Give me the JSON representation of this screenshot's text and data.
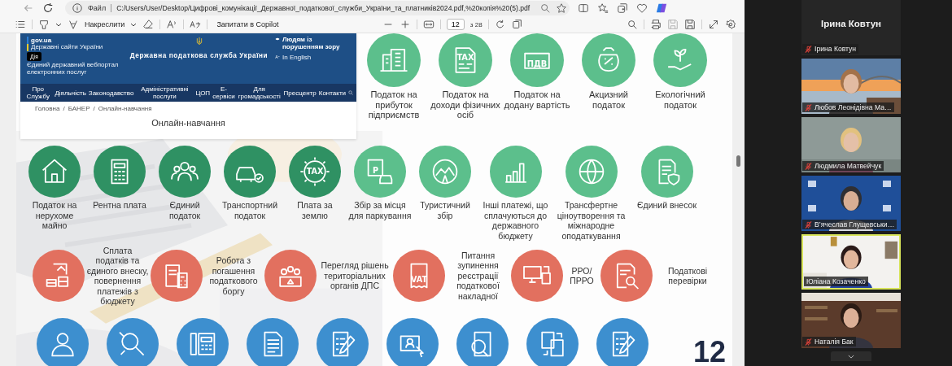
{
  "browser": {
    "address_bar": {
      "scheme": "Файл",
      "url": "C:/Users/User/Desktop/Цифрові_комунікації_Державної_податкової_служби_України_та_платників2024.pdf,%20копія%20(5).pdf"
    },
    "pdf_toolbar": {
      "draw_label": "Накреслити",
      "copilot_label": "Запитати в Copilot",
      "page": "12",
      "page_total": "з 28"
    }
  },
  "slide": {
    "website": {
      "gov_logo": "gov.ua",
      "gov_caption": "Державні сайти України",
      "diia_logo": "Дія",
      "diia_caption": "Єдиний державний вебпортал електронних послуг",
      "title": "Державна податкова служба України",
      "accessibility": "Людям із порушенням зору",
      "language": "In English",
      "nav": [
        "Про Службу",
        "Діяльність",
        "Законодавство",
        "Адміністративні послуги",
        "ЦОП",
        "Е-сервіси",
        "Для громадськості",
        "Пресцентр",
        "Контакти"
      ],
      "breadcrumbs": [
        "Головна",
        "БАНЕР",
        "Онлайн-навчання"
      ],
      "breadcrumb_separator": "/",
      "heading": "Онлайн-навчання"
    },
    "rows": [
      {
        "kind": "below",
        "color": "#5cbf8c",
        "items": [
          {
            "kind": "labeled",
            "label": "Податок на прибуток підприємств"
          },
          {
            "kind": "labeled",
            "label": "Податок на доходи фізичних осіб",
            "icon_text": "TAX"
          },
          {
            "kind": "labeled",
            "label": "Податок на додану вартість",
            "icon_text": "ПДВ"
          },
          {
            "kind": "labeled",
            "label": "Акцизний податок"
          },
          {
            "kind": "labeled",
            "label": "Екологічний податок"
          }
        ]
      },
      {
        "kind": "below",
        "color": "#5cbf8c",
        "items": [
          {
            "kind": "labeled",
            "label": "Податок на нерухоме майно",
            "color": "#2f9163"
          },
          {
            "kind": "labeled",
            "label": "Рентна плата",
            "color": "#2f9163"
          },
          {
            "kind": "labeled",
            "label": "Єдиний податок",
            "color": "#2f9163"
          },
          {
            "kind": "labeled",
            "label": "Транспортний податок",
            "color": "#2f9163"
          },
          {
            "kind": "labeled",
            "label": "Плата за землю",
            "icon_text": "TAX",
            "color": "#2f9163"
          },
          {
            "kind": "labeled",
            "label": "Збір за місця для паркування",
            "icon_text": "P"
          },
          {
            "kind": "labeled",
            "label": "Туристичний збір"
          },
          {
            "kind": "labeled",
            "label": "Інші платежі, що сплачуються до державного бюджету"
          },
          {
            "kind": "labeled",
            "label": "Трансфертне ціноутворення та міжнародне оподаткування"
          },
          {
            "kind": "labeled",
            "label": "Єдиний внесок"
          }
        ]
      },
      {
        "kind": "right",
        "color": "#e2705f",
        "items": [
          {
            "kind": "labeled",
            "label": "Сплата податків та єдиного внеску, повернення платежів з бюджету"
          },
          {
            "kind": "labeled",
            "label": "Робота з погашення податкового боргу"
          },
          {
            "kind": "labeled",
            "label": "Перегляд рішень територіальних органів ДПС"
          },
          {
            "kind": "labeled",
            "label": "Питання зупинення реєстрації податкової накладної",
            "icon_text": "VAT"
          },
          {
            "kind": "labeled",
            "label": "РРО/ ПРРО"
          },
          {
            "kind": "labeled",
            "label": "Податкові перевірки"
          }
        ]
      },
      {
        "kind": "below",
        "color": "#3d8fcf",
        "items": [
          {
            "kind": "icon"
          },
          {
            "kind": "icon"
          },
          {
            "kind": "icon"
          },
          {
            "kind": "icon"
          },
          {
            "kind": "icon"
          },
          {
            "kind": "icon"
          },
          {
            "kind": "icon"
          },
          {
            "kind": "icon"
          },
          {
            "kind": "icon"
          }
        ]
      }
    ],
    "page_number": "12"
  },
  "meeting": {
    "participants": [
      {
        "kind": "name_card",
        "display_name": "Ірина Ковтун",
        "name": "Ірина Ковтун",
        "muted": true,
        "speaking": false
      },
      {
        "kind": "video",
        "name": "Любов Леонідівна Ма…",
        "muted": true,
        "speaking": false
      },
      {
        "kind": "video",
        "name": "Людмила Матвейчук",
        "muted": true,
        "speaking": false
      },
      {
        "kind": "video",
        "name": "В’ячеслав Глущевськи…",
        "muted": true,
        "speaking": false
      },
      {
        "kind": "video",
        "name": "Юліана Козаченко",
        "muted": false,
        "speaking": true
      },
      {
        "kind": "video",
        "name": "Наталія Бак",
        "muted": true,
        "speaking": false
      }
    ]
  }
}
